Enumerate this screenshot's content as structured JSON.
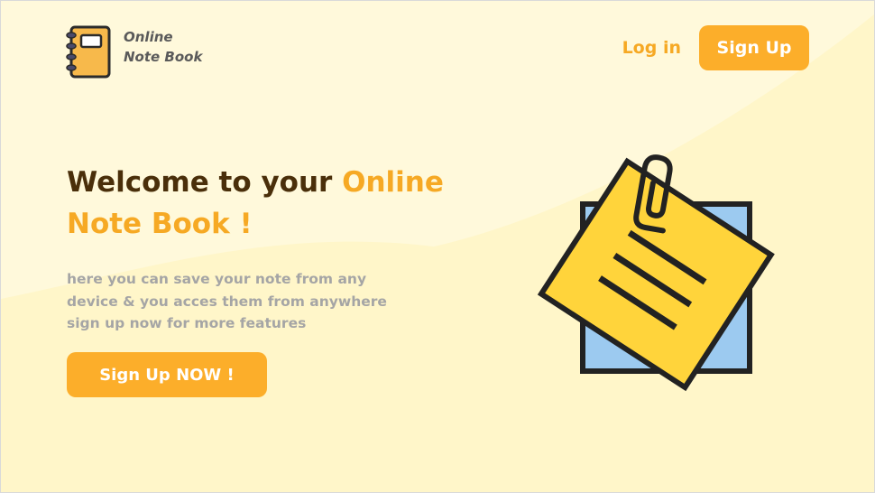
{
  "brand": {
    "line1": "Online",
    "line2": "Note Book"
  },
  "nav": {
    "login_label": "Log in",
    "signup_label": "Sign Up"
  },
  "hero": {
    "title_prefix": "Welcome to your ",
    "title_accent_1": "Online",
    "title_accent_2": "Note Book !",
    "description_lines": [
      "here you can save your note from any",
      "device & you acces them from anywhere",
      "sign up now for more features"
    ],
    "cta_label": "Sign Up NOW !"
  },
  "colors": {
    "accent": "#fcae2a",
    "heading": "#4a2f0a",
    "muted_text": "#a5a5a5",
    "background": "#fff9db",
    "background_alt": "#fff6c9",
    "sticky_note": "#ffd43b",
    "back_note": "#9ccaf0"
  },
  "icons": {
    "logo": "notebook-icon",
    "illustration": "sticky-note-with-paperclip-icon"
  }
}
